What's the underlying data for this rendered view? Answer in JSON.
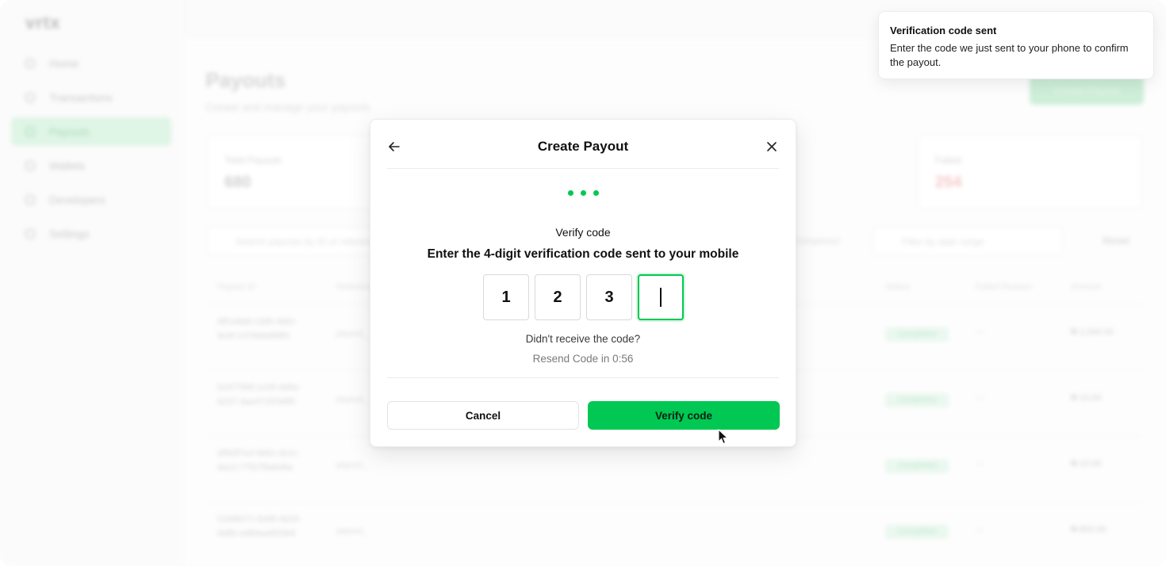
{
  "app": {
    "logo": "vrtx",
    "sidebar": {
      "items": [
        {
          "label": "Home",
          "active": false
        },
        {
          "label": "Transactions",
          "active": false
        },
        {
          "label": "Payouts",
          "active": true
        },
        {
          "label": "Wallets",
          "active": false
        },
        {
          "label": "Developers",
          "active": false
        },
        {
          "label": "Settings",
          "active": false
        }
      ]
    },
    "page": {
      "title": "Payouts",
      "subtitle": "Create and manage your payouts",
      "create_button": "Create Payout"
    },
    "stats": [
      {
        "label": "Total Payouts",
        "value": "680"
      },
      {
        "label": "Failed",
        "value": "254"
      }
    ],
    "filters": {
      "search_placeholder": "Search payouts by ID or reference",
      "status_label": "Completed",
      "date_placeholder": "Filter by date range",
      "reset_label": "Reset"
    },
    "table": {
      "columns": [
        "Payout ID",
        "Reference",
        "Status",
        "Failed Reason",
        "Amount"
      ],
      "rows": [
        {
          "id": "0ff1a9a8-c3d9-4d0c-9c4f-147694488ff1",
          "ref": "payout_",
          "status": "Completed",
          "reason": "—",
          "amount": "₦ 1,000.00"
        },
        {
          "id": "b2477b6f-1c09-4d9e-b237-3ae471f23d85",
          "ref": "payout_",
          "status": "Completed",
          "reason": "—",
          "amount": "₦ 10.00"
        },
        {
          "id": "d6b5f7e4-9d0c-4e1c-9a12-77f37f9a8d6a",
          "ref": "payout_",
          "status": "Completed",
          "reason": "—",
          "amount": "₦ 10.00"
        },
        {
          "id": "01b6fa71-6a98-4b29-8d6b-ed89aa9f296d",
          "ref": "payout_",
          "status": "Completed",
          "reason": "—",
          "amount": "₦ 800.00"
        }
      ]
    }
  },
  "modal": {
    "title": "Create Payout",
    "step_count": 3,
    "verify_label": "Verify code",
    "instruction": "Enter the 4-digit verification code sent to your mobile",
    "code_digits": [
      "1",
      "2",
      "3",
      ""
    ],
    "resend_question": "Didn't receive the code?",
    "resend_timer": "Resend Code in 0:56",
    "cancel_label": "Cancel",
    "verify_button_label": "Verify code",
    "accent_color": "#00c853"
  },
  "toast": {
    "title": "Verification code sent",
    "body": "Enter the code we just sent to your phone to confirm the payout."
  }
}
